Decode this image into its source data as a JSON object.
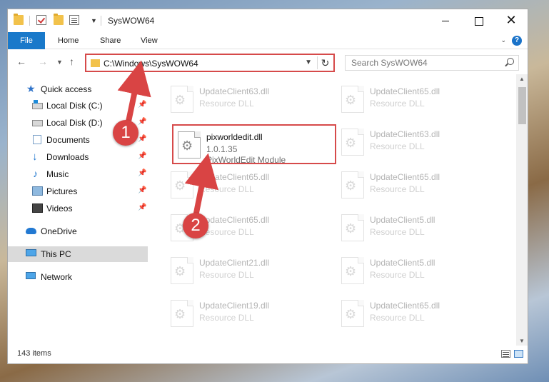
{
  "window": {
    "title": "SysWOW64",
    "minimize": "",
    "maximize": "",
    "close": "✕"
  },
  "ribbon": {
    "tabs": [
      "File",
      "Home",
      "Share",
      "View"
    ],
    "help": "?"
  },
  "address": {
    "path": "C:\\Windows\\SysWOW64",
    "search_placeholder": "Search SysWOW64"
  },
  "sidebar": {
    "items": [
      {
        "label": "Quick access",
        "icon": "star-icon"
      },
      {
        "label": "Local Disk (C:)",
        "icon": "drive-icon",
        "pinned": true
      },
      {
        "label": "Local Disk (D:)",
        "icon": "drive-icon",
        "pinned": true
      },
      {
        "label": "Documents",
        "icon": "documents-icon",
        "pinned": true
      },
      {
        "label": "Downloads",
        "icon": "downloads-icon",
        "pinned": true
      },
      {
        "label": "Music",
        "icon": "music-icon",
        "pinned": true
      },
      {
        "label": "Pictures",
        "icon": "pictures-icon",
        "pinned": true
      },
      {
        "label": "Videos",
        "icon": "videos-icon",
        "pinned": true
      },
      {
        "label": "OneDrive",
        "icon": "onedrive-icon"
      },
      {
        "label": "This PC",
        "icon": "this-pc-icon",
        "selected": true
      },
      {
        "label": "Network",
        "icon": "network-icon"
      }
    ]
  },
  "files": {
    "highlighted": {
      "name": "pixworldedit.dll",
      "version": "1.0.1.35",
      "description": "PixWorldEdit Module"
    },
    "left_column": [
      {
        "name": "UpdateClient63.dll",
        "type": "Resource DLL"
      },
      {
        "name": "UpdateClient65.dll",
        "type": "Resource DLL"
      },
      {
        "name": "UpdateClient65.dll",
        "type": "Resource DLL"
      },
      {
        "name": "UpdateClient21.dll",
        "type": "Resource DLL"
      },
      {
        "name": "UpdateClient19.dll",
        "type": "Resource DLL"
      }
    ],
    "right_column": [
      {
        "name": "UpdateClient65.dll",
        "type": "Resource DLL"
      },
      {
        "name": "UpdateClient63.dll",
        "type": "Resource DLL"
      },
      {
        "name": "UpdateClient65.dll",
        "type": "Resource DLL"
      },
      {
        "name": "UpdateClient5.dll",
        "type": "Resource DLL"
      },
      {
        "name": "UpdateClient5.dll",
        "type": "Resource DLL"
      },
      {
        "name": "UpdateClient65.dll",
        "type": "Resource DLL"
      }
    ]
  },
  "status": {
    "item_count": "143 items"
  },
  "annotations": {
    "step1": "1",
    "step2": "2",
    "color": "#d94444"
  }
}
